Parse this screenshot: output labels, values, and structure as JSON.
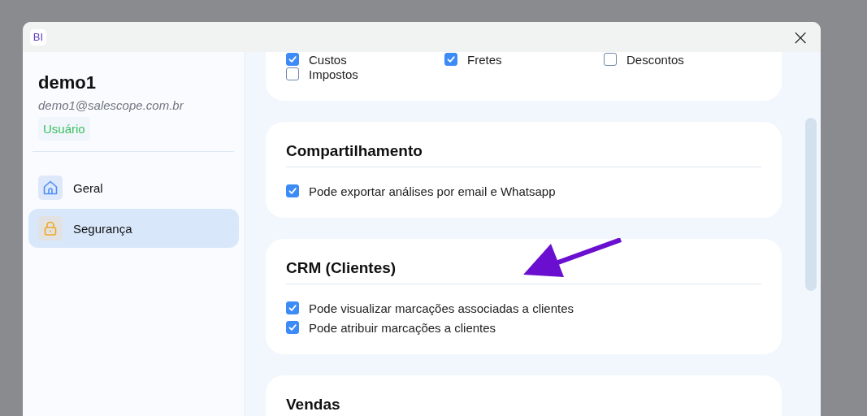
{
  "window": {
    "logo": "BI",
    "close": "×"
  },
  "user": {
    "name": "demo1",
    "email": "demo1@salescope.com.br",
    "role": "Usuário"
  },
  "nav": [
    {
      "label": "Geral",
      "kind": "home",
      "selected": false
    },
    {
      "label": "Segurança",
      "kind": "lock",
      "selected": true
    }
  ],
  "sections": [
    {
      "kind": "grid",
      "items": [
        {
          "label": "Custos",
          "checked": true
        },
        {
          "label": "Fretes",
          "checked": true
        },
        {
          "label": "Descontos",
          "checked": false
        },
        {
          "label": "Impostos",
          "checked": false
        }
      ]
    },
    {
      "kind": "list",
      "title": "Compartilhamento",
      "items": [
        {
          "label": "Pode exportar análises por email e Whatsapp",
          "checked": true
        }
      ]
    },
    {
      "kind": "list",
      "title": "CRM (Clientes)",
      "items": [
        {
          "label": "Pode visualizar marcações associadas a clientes",
          "checked": true
        },
        {
          "label": "Pode atribuir marcações a clientes",
          "checked": true
        }
      ]
    },
    {
      "title": "Vendas"
    }
  ]
}
